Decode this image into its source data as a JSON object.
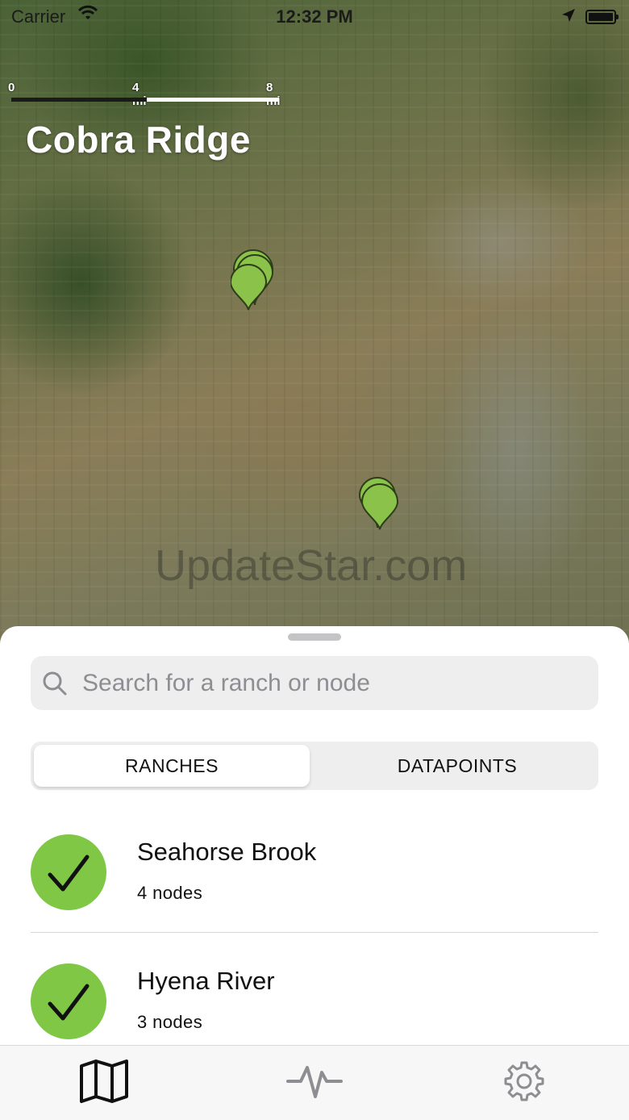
{
  "status_bar": {
    "carrier": "Carrier",
    "time": "12:32 PM"
  },
  "map": {
    "scale": {
      "labels": [
        "0",
        "4 mi",
        "8 mi"
      ]
    },
    "title": "Cobra Ridge",
    "watermark": "UpdateStar.com",
    "pin_color": "#8bc34a"
  },
  "search": {
    "placeholder": "Search for a ranch or node",
    "value": ""
  },
  "segments": [
    {
      "label": "RANCHES",
      "selected": true
    },
    {
      "label": "DATAPOINTS",
      "selected": false
    }
  ],
  "ranches": [
    {
      "name": "Seahorse Brook",
      "count": "4 nodes",
      "status": "ok"
    },
    {
      "name": "Hyena River",
      "count": "3 nodes",
      "status": "ok"
    }
  ],
  "tabs": [
    {
      "icon": "map-icon",
      "selected": true
    },
    {
      "icon": "activity-icon",
      "selected": false
    },
    {
      "icon": "gear-icon",
      "selected": false
    }
  ],
  "colors": {
    "accent_green": "#7fc745",
    "tab_selected": "#111111",
    "tab_unselected": "#8e8e92"
  }
}
